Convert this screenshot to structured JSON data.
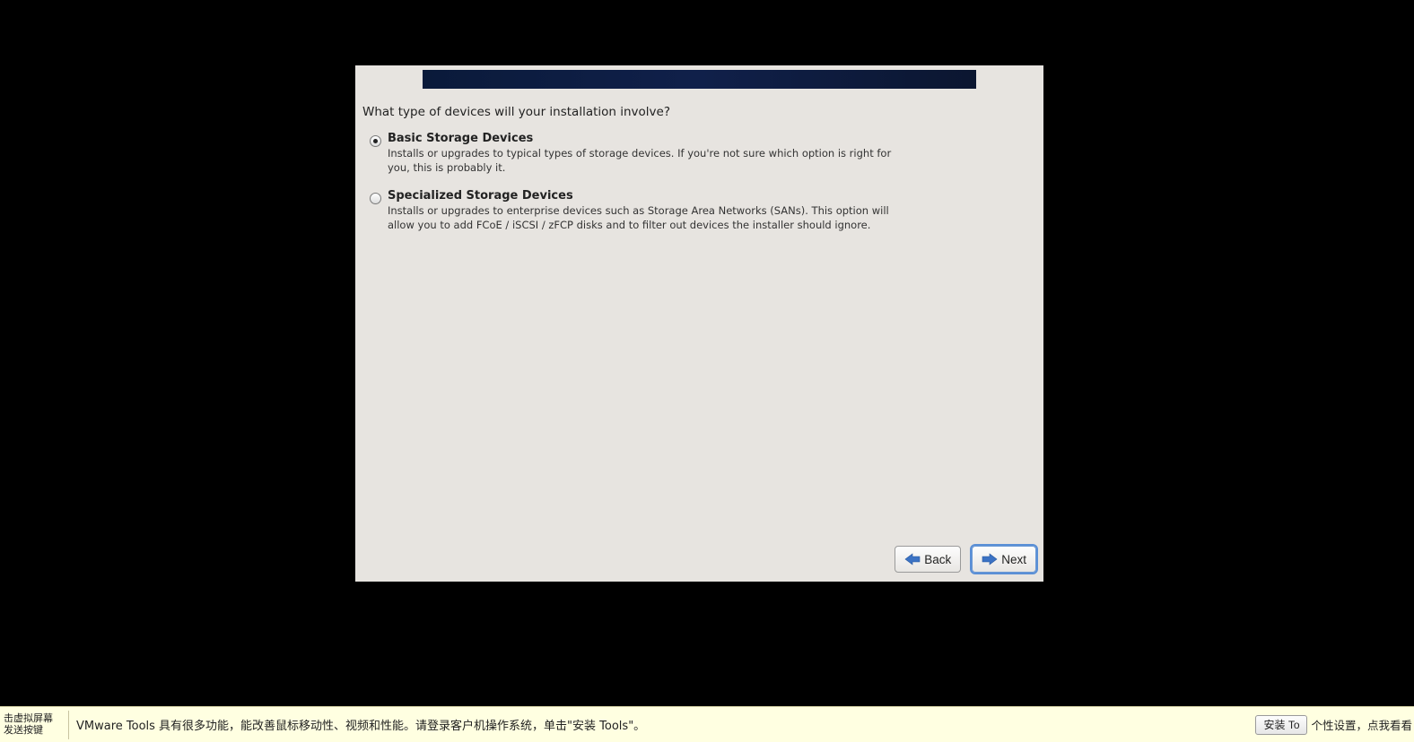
{
  "installer": {
    "question": "What type of devices will your installation involve?",
    "options": [
      {
        "title": "Basic Storage Devices",
        "desc": "Installs or upgrades to typical types of storage devices.  If you're not sure which option is right for you, this is probably it.",
        "selected": true
      },
      {
        "title": "Specialized Storage Devices",
        "desc": "Installs or upgrades to enterprise devices such as Storage Area Networks (SANs). This option will allow you to add FCoE / iSCSI / zFCP disks and to filter out devices the installer should ignore.",
        "selected": false
      }
    ],
    "buttons": {
      "back": "Back",
      "next": "Next"
    }
  },
  "hintbar": {
    "left": "击虚拟屏幕\n发送按键",
    "message": "VMware Tools 具有很多功能，能改善鼠标移动性、视频和性能。请登录客户机操作系统，单击\"安装 Tools\"。",
    "install_button": "安装 To",
    "overlay": "个性设置，点我看看"
  }
}
